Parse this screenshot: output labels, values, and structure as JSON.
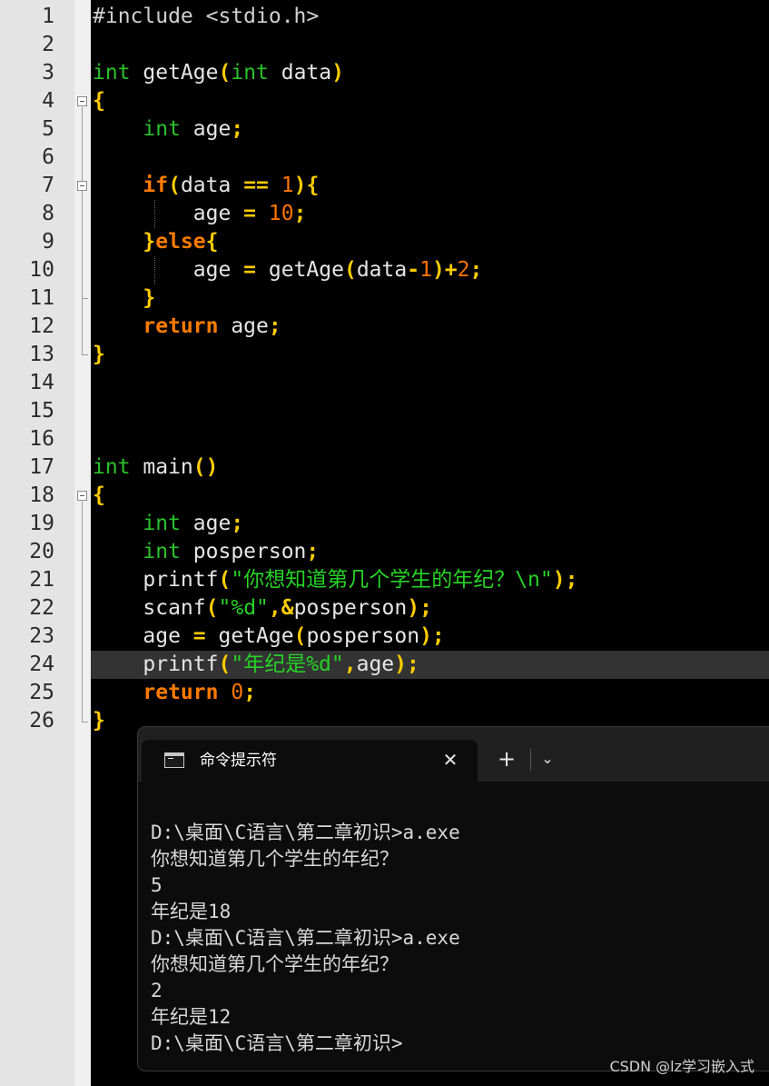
{
  "editor": {
    "line_numbers": [
      "1",
      "2",
      "3",
      "4",
      "5",
      "6",
      "7",
      "8",
      "9",
      "10",
      "11",
      "12",
      "13",
      "14",
      "15",
      "16",
      "17",
      "18",
      "19",
      "20",
      "21",
      "22",
      "23",
      "24",
      "25",
      "26"
    ],
    "code": {
      "l1": [
        "#include <stdio.h>"
      ],
      "l3": [
        "int",
        " getAge",
        "(",
        "int",
        " data",
        ")"
      ],
      "l4": [
        "{"
      ],
      "l5": [
        "    ",
        "int",
        " age",
        ";"
      ],
      "l7": [
        "    ",
        "if",
        "(",
        "data ",
        "==",
        " ",
        "1",
        ")",
        "{"
      ],
      "l8": [
        "        ",
        "age ",
        "=",
        " ",
        "10",
        ";"
      ],
      "l9": [
        "    ",
        "}",
        "else",
        "{"
      ],
      "l10": [
        "        ",
        "age ",
        "=",
        " getAge",
        "(",
        "data",
        "-",
        "1",
        ")",
        "+",
        "2",
        ";"
      ],
      "l11": [
        "    ",
        "}"
      ],
      "l12": [
        "    ",
        "return",
        " age",
        ";"
      ],
      "l13": [
        "}"
      ],
      "l17": [
        "int",
        " main",
        "()"
      ],
      "l18": [
        "{"
      ],
      "l19": [
        "    ",
        "int",
        " age",
        ";"
      ],
      "l20": [
        "    ",
        "int",
        " posperson",
        ";"
      ],
      "l21": [
        "    ",
        "printf",
        "(",
        "\"你想知道第几个学生的年纪？\\n\"",
        ")",
        ";"
      ],
      "l22": [
        "    ",
        "scanf",
        "(",
        "\"%d\"",
        ",",
        "&",
        "posperson",
        ")",
        ";"
      ],
      "l23": [
        "    ",
        "age ",
        "=",
        " getAge",
        "(",
        "posperson",
        ")",
        ";"
      ],
      "l24": [
        "    ",
        "printf",
        "(",
        "\"年纪是%d\"",
        ",",
        "age",
        ")",
        ";"
      ],
      "l25": [
        "    ",
        "return",
        " ",
        "0",
        ";"
      ],
      "l26": [
        "}"
      ]
    }
  },
  "terminal": {
    "tab_title": "命令提示符",
    "tab_icon": "cmd-prompt-icon",
    "close_label": "✕",
    "new_tab_label": "+",
    "dropdown_label": "⌄",
    "lines": [
      "D:\\桌面\\C语言\\第二章初识>a.exe",
      "你想知道第几个学生的年纪？",
      "5",
      "年纪是18",
      "D:\\桌面\\C语言\\第二章初识>a.exe",
      "你想知道第几个学生的年纪？",
      "2",
      "年纪是12",
      "D:\\桌面\\C语言\\第二章初识>"
    ]
  },
  "watermark": "CSDN @lz学习嵌入式",
  "colors": {
    "keyword": "#ff7b00",
    "type": "#2ac22a",
    "operator": "#ffcc00",
    "number": "#ff7400",
    "string": "#26d226",
    "gutter": "#e4e4e4",
    "editor_bg": "#000000",
    "terminal_bg": "#0c0c0c"
  }
}
